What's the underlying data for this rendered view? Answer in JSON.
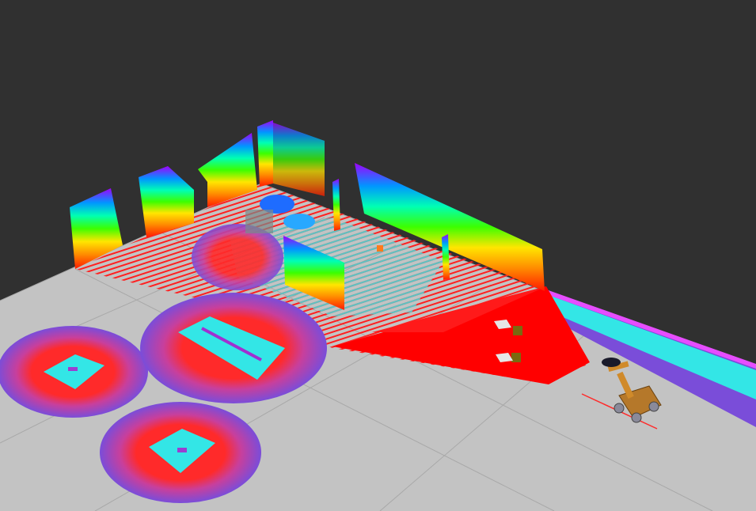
{
  "colors": {
    "background": "#303030",
    "floor": "#c3c3c3",
    "grid_line": "#9a9a9a",
    "laser_scan": "#ff0000",
    "costmap_inner": "#33e6e6",
    "costmap_mid": "#ff3333",
    "costmap_outer": "#7a4dd9",
    "costmap_edge": "#e64dff",
    "robot_body": "#b5782a",
    "robot_arm": "#d08a2a",
    "marker": "#7a6a10"
  },
  "icons": [
    "robot-icon",
    "lidar-sensor-icon",
    "target-marker-icon"
  ]
}
